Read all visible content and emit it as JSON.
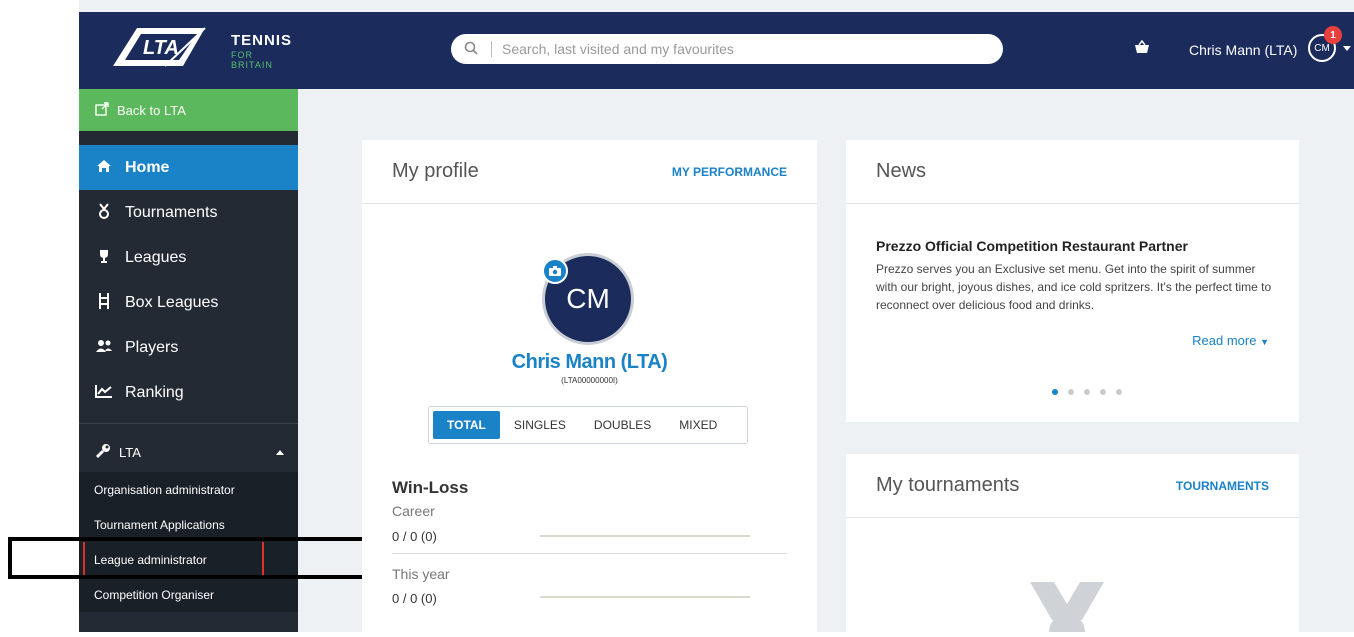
{
  "header": {
    "logo_lta": "LTA",
    "logo_line1": "TENNIS",
    "logo_line2": "FOR BRITAIN",
    "search_placeholder": "Search, last visited and my favourites",
    "user_name": "Chris Mann (LTA)",
    "user_initials": "CM",
    "notification_count": "1"
  },
  "sidebar": {
    "back_label": "Back to LTA",
    "items": [
      {
        "label": "Home",
        "icon": "home-icon"
      },
      {
        "label": "Tournaments",
        "icon": "medal-icon"
      },
      {
        "label": "Leagues",
        "icon": "trophy-icon"
      },
      {
        "label": "Box Leagues",
        "icon": "ladder-icon"
      },
      {
        "label": "Players",
        "icon": "players-icon"
      },
      {
        "label": "Ranking",
        "icon": "chart-icon"
      }
    ],
    "section_label": "LTA",
    "sub_items": [
      {
        "label": "Organisation administrator"
      },
      {
        "label": "Tournament Applications"
      },
      {
        "label": "League administrator"
      },
      {
        "label": "Competition Organiser"
      }
    ]
  },
  "profile": {
    "title": "My profile",
    "link": "MY PERFORMANCE",
    "initials": "CM",
    "name": "Chris Mann (LTA)",
    "member_id": "(LTA00000000I)",
    "tabs": [
      "TOTAL",
      "SINGLES",
      "DOUBLES",
      "MIXED"
    ],
    "winloss_title": "Win-Loss",
    "career_label": "Career",
    "career_value": "0 / 0 (0)",
    "year_label": "This year",
    "year_value": "0 / 0 (0)"
  },
  "news": {
    "title": "News",
    "headline": "Prezzo Official Competition Restaurant Partner",
    "body": "Prezzo serves you an Exclusive set menu. Get into the spirit of summer with our bright, joyous dishes, and ice cold spritzers. It's the perfect time to reconnect over delicious food and drinks.",
    "read_more": "Read more",
    "slides": 5,
    "active_slide": 0
  },
  "tournaments": {
    "title": "My tournaments",
    "link": "TOURNAMENTS"
  },
  "colors": {
    "navy": "#1a2b5c",
    "accent": "#1a82c7",
    "green": "#5cb85c",
    "sidebar": "#232a33"
  }
}
